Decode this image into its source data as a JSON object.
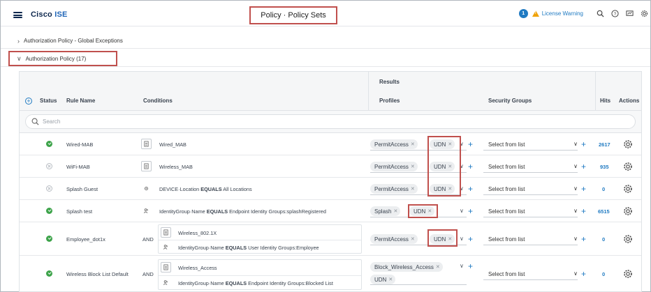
{
  "header": {
    "brand_cisco": "Cisco",
    "brand_ise": "ISE",
    "page_title": "Policy · Policy Sets",
    "notification_count": "1",
    "license_warning": "License Warning"
  },
  "sections": {
    "global_exceptions": "Authorization Policy - Global Exceptions",
    "authorization_policy": "Authorization Policy (17)"
  },
  "table": {
    "headers": {
      "status": "Status",
      "rule_name": "Rule Name",
      "conditions": "Conditions",
      "results": "Results",
      "profiles": "Profiles",
      "security_groups": "Security Groups",
      "hits": "Hits",
      "actions": "Actions"
    },
    "search_placeholder": "Search",
    "rows": [
      {
        "status": "enabled",
        "name": "Wired-MAB",
        "conditions": [
          {
            "icon": "document-icon",
            "text": "Wired_MAB"
          }
        ],
        "profiles": [
          "PermitAccess",
          "UDN"
        ],
        "security_group": "Select from list",
        "hits": "2617"
      },
      {
        "status": "disabled",
        "name": "WiFi-MAB",
        "conditions": [
          {
            "icon": "document-icon",
            "text": "Wireless_MAB"
          }
        ],
        "profiles": [
          "PermitAccess",
          "UDN"
        ],
        "security_group": "Select from list",
        "hits": "935"
      },
      {
        "status": "disabled",
        "name": "Splash Guest",
        "conditions": [
          {
            "icon": "location-icon",
            "attr": "DEVICE·Location",
            "op": "EQUALS",
            "value": "All Locations"
          }
        ],
        "profiles": [
          "PermitAccess",
          "UDN"
        ],
        "security_group": "Select from list",
        "hits": "0"
      },
      {
        "status": "enabled",
        "name": "Splash test",
        "conditions": [
          {
            "icon": "identity-group-icon",
            "attr": "IdentityGroup·Name",
            "op": "EQUALS",
            "value": "Endpoint Identity Groups:splashRegistered"
          }
        ],
        "profiles": [
          "Splash",
          "UDN"
        ],
        "security_group": "Select from list",
        "hits": "6515"
      },
      {
        "status": "enabled",
        "name": "Employee_dot1x",
        "operator": "AND",
        "conditions": [
          {
            "icon": "document-icon",
            "text": "Wireless_802.1X"
          },
          {
            "icon": "identity-group-icon",
            "attr": "IdentityGroup·Name",
            "op": "EQUALS",
            "value": "User Identity Groups:Employee"
          }
        ],
        "profiles": [
          "PermitAccess",
          "UDN"
        ],
        "security_group": "Select from list",
        "hits": "0"
      },
      {
        "status": "enabled",
        "name": "Wireless Block List Default",
        "operator": "AND",
        "conditions": [
          {
            "icon": "document-icon",
            "text": "Wireless_Access"
          },
          {
            "icon": "identity-group-icon",
            "attr": "IdentityGroup·Name",
            "op": "EQUALS",
            "value": "Endpoint Identity Groups:Blocked List"
          }
        ],
        "profiles": [
          "Block_Wireless_Access",
          "UDN"
        ],
        "security_group": "Select from list",
        "hits": "0"
      }
    ]
  },
  "icons": {
    "menu": "hamburger-icon",
    "search": "search-icon",
    "help": "help-icon",
    "dashboard": "dashboard-icon",
    "settings": "gear-icon"
  },
  "colors": {
    "brand": "#0d274d",
    "link": "#1f7ac2",
    "highlight": "#c0504d",
    "enabled": "#3da34a",
    "warning": "#f0a30a"
  }
}
